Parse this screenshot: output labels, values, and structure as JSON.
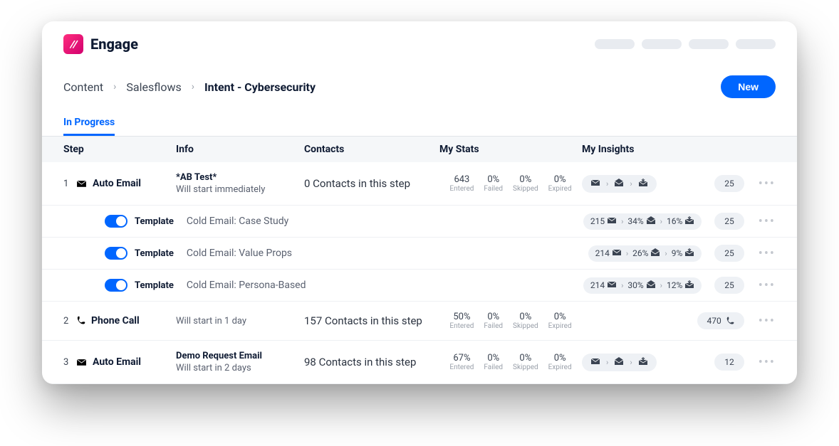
{
  "brand": {
    "name": "Engage"
  },
  "breadcrumb": {
    "items": [
      "Content",
      "Salesflows"
    ],
    "current": "Intent - Cybersecurity"
  },
  "actions": {
    "new": "New"
  },
  "tabs": {
    "active": "In Progress"
  },
  "columns": {
    "step": "Step",
    "info": "Info",
    "contacts": "Contacts",
    "stats": "My Stats",
    "insights": "My Insights"
  },
  "stat_labels": {
    "entered": "Entered",
    "failed": "Failed",
    "skipped": "Skipped",
    "expired": "Expired"
  },
  "template_label": "Template",
  "steps": [
    {
      "num": "1",
      "type": "email",
      "name": "Auto Email",
      "info_title": "*AB Test*",
      "info_sub": "Will start immediately",
      "contacts": "0 Contacts in this step",
      "stats": {
        "entered": "643",
        "failed": "0%",
        "skipped": "0%",
        "expired": "0%"
      },
      "insight_count": "25",
      "templates": [
        {
          "name": "Cold Email: Case Study",
          "p": [
            "215",
            "34%",
            "16%"
          ],
          "count": "25"
        },
        {
          "name": "Cold Email: Value Props",
          "p": [
            "214",
            "26%",
            "9%"
          ],
          "count": "25"
        },
        {
          "name": "Cold Email: Persona-Based",
          "p": [
            "214",
            "30%",
            "12%"
          ],
          "count": "25"
        }
      ]
    },
    {
      "num": "2",
      "type": "phone",
      "name": "Phone Call",
      "info_title": "",
      "info_sub": "Will start in 1 day",
      "contacts": "157 Contacts in this step",
      "stats": {
        "entered": "50%",
        "failed": "0%",
        "skipped": "0%",
        "expired": "0%"
      },
      "insight_count": "470",
      "templates": []
    },
    {
      "num": "3",
      "type": "email",
      "name": "Auto Email",
      "info_title": "Demo Request Email",
      "info_sub": "Will start in 2 days",
      "contacts": "98 Contacts in this step",
      "stats": {
        "entered": "67%",
        "failed": "0%",
        "skipped": "0%",
        "expired": "0%"
      },
      "insight_count": "12",
      "templates": []
    }
  ]
}
